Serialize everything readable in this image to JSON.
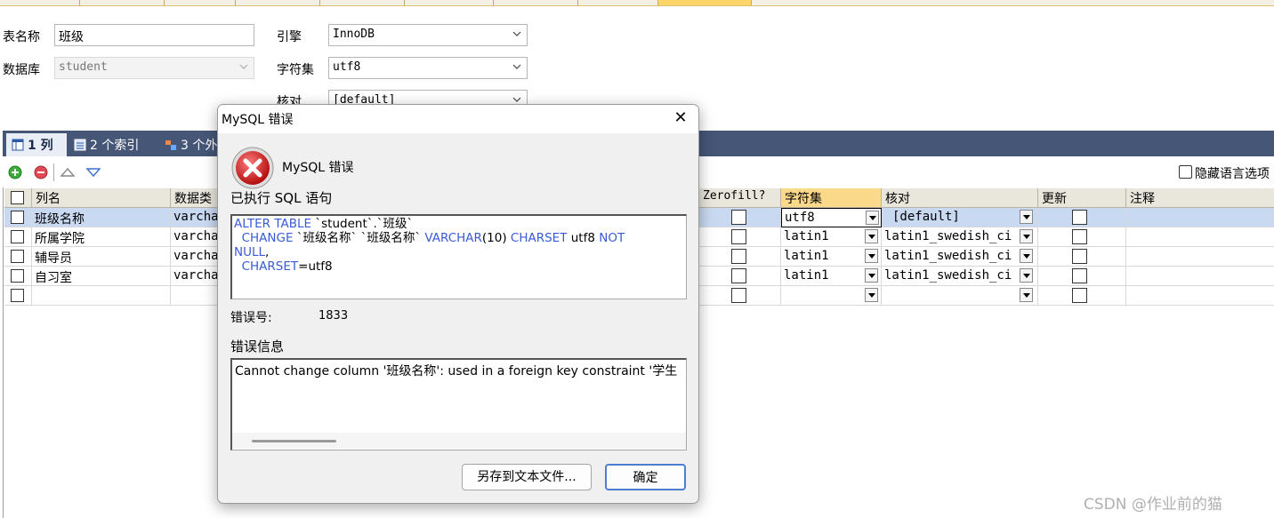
{
  "form": {
    "table_name_label": "表名称",
    "table_name_value": "班级",
    "database_label": "数据库",
    "database_value": "student",
    "engine_label": "引擎",
    "engine_value": "InnoDB",
    "charset_label": "字符集",
    "charset_value": "utf8",
    "collation_label": "核对",
    "collation_value": "[default]"
  },
  "tabs": [
    {
      "label": "1 列"
    },
    {
      "label": "2 个索引"
    },
    {
      "label": "3 个外"
    }
  ],
  "toolbar": {
    "hide_language_option": "隐藏语言选项"
  },
  "grid": {
    "headers": {
      "col_name": "列名",
      "data_type": "数据类",
      "zerofill": "Zerofill?",
      "charset": "字符集",
      "collation": "核对",
      "update": "更新",
      "comment": "注释"
    },
    "rows": [
      {
        "name": "班级名称",
        "type": "varcha",
        "charset": "utf8",
        "collation": "[default]"
      },
      {
        "name": "所属学院",
        "type": "varcha",
        "charset": "latin1",
        "collation": "latin1_swedish_ci"
      },
      {
        "name": "辅导员",
        "type": "varcha",
        "charset": "latin1",
        "collation": "latin1_swedish_ci"
      },
      {
        "name": "自习室",
        "type": "varcha",
        "charset": "latin1",
        "collation": "latin1_swedish_ci"
      },
      {
        "name": "",
        "type": "",
        "charset": "",
        "collation": ""
      }
    ]
  },
  "dialog": {
    "title": "MySQL 错误",
    "heading": "MySQL 错误",
    "executed_sql_label": "已执行 SQL 语句",
    "sql": {
      "l1_kw": "ALTER TABLE",
      "l1_rest": " `student`.`班级`",
      "l2_kw": "CHANGE",
      "l2_rest": " `班级名称` `班级名称` ",
      "l2_kw2": "VARCHAR",
      "l2_num": "(10) ",
      "l2_kw3": "CHARSET",
      "l2_rest2": " utf8 ",
      "l2_kw4": "NOT",
      "l3_kw": "NULL",
      "l3_rest": ",",
      "l4_kw": "CHARSET",
      "l4_rest": "=utf8"
    },
    "error_no_label": "错误号:",
    "error_no": "1833",
    "error_info_label": "错误信息",
    "error_message": "Cannot change column '班级名称': used in a foreign key constraint '学生",
    "save_button": "另存到文本文件...",
    "ok_button": "确定",
    "close_glyph": "✕"
  },
  "watermark": "CSDN @作业前的猫"
}
